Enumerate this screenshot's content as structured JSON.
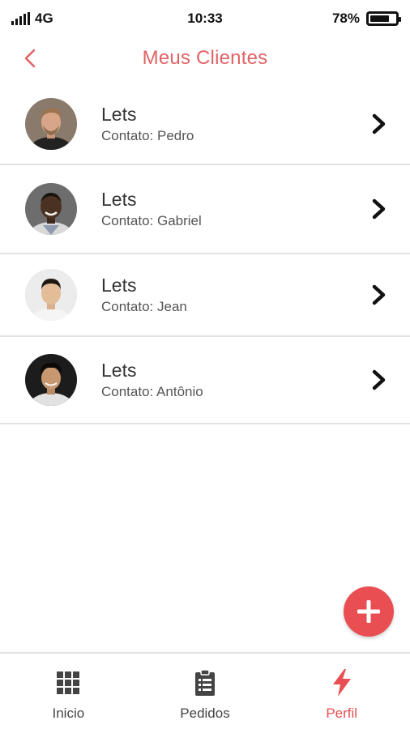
{
  "status_bar": {
    "network": "4G",
    "time": "10:33",
    "battery": "78%",
    "battery_level": 0.78
  },
  "header": {
    "title": "Meus Clientes"
  },
  "clients": [
    {
      "name": "Lets",
      "contact": "Contato: Pedro"
    },
    {
      "name": "Lets",
      "contact": "Contato: Gabriel"
    },
    {
      "name": "Lets",
      "contact": "Contato: Jean"
    },
    {
      "name": "Lets",
      "contact": "Contato: Antônio"
    }
  ],
  "fab": {
    "icon": "plus-icon"
  },
  "bottom_nav": {
    "items": [
      {
        "label": "Inicio",
        "icon": "grid-icon",
        "active": false
      },
      {
        "label": "Pedidos",
        "icon": "clipboard-icon",
        "active": false
      },
      {
        "label": "Perfil",
        "icon": "lightning-icon",
        "active": true
      }
    ]
  },
  "colors": {
    "accent": "#e94f52",
    "title": "#e06366",
    "divider": "#e2e2e2"
  }
}
